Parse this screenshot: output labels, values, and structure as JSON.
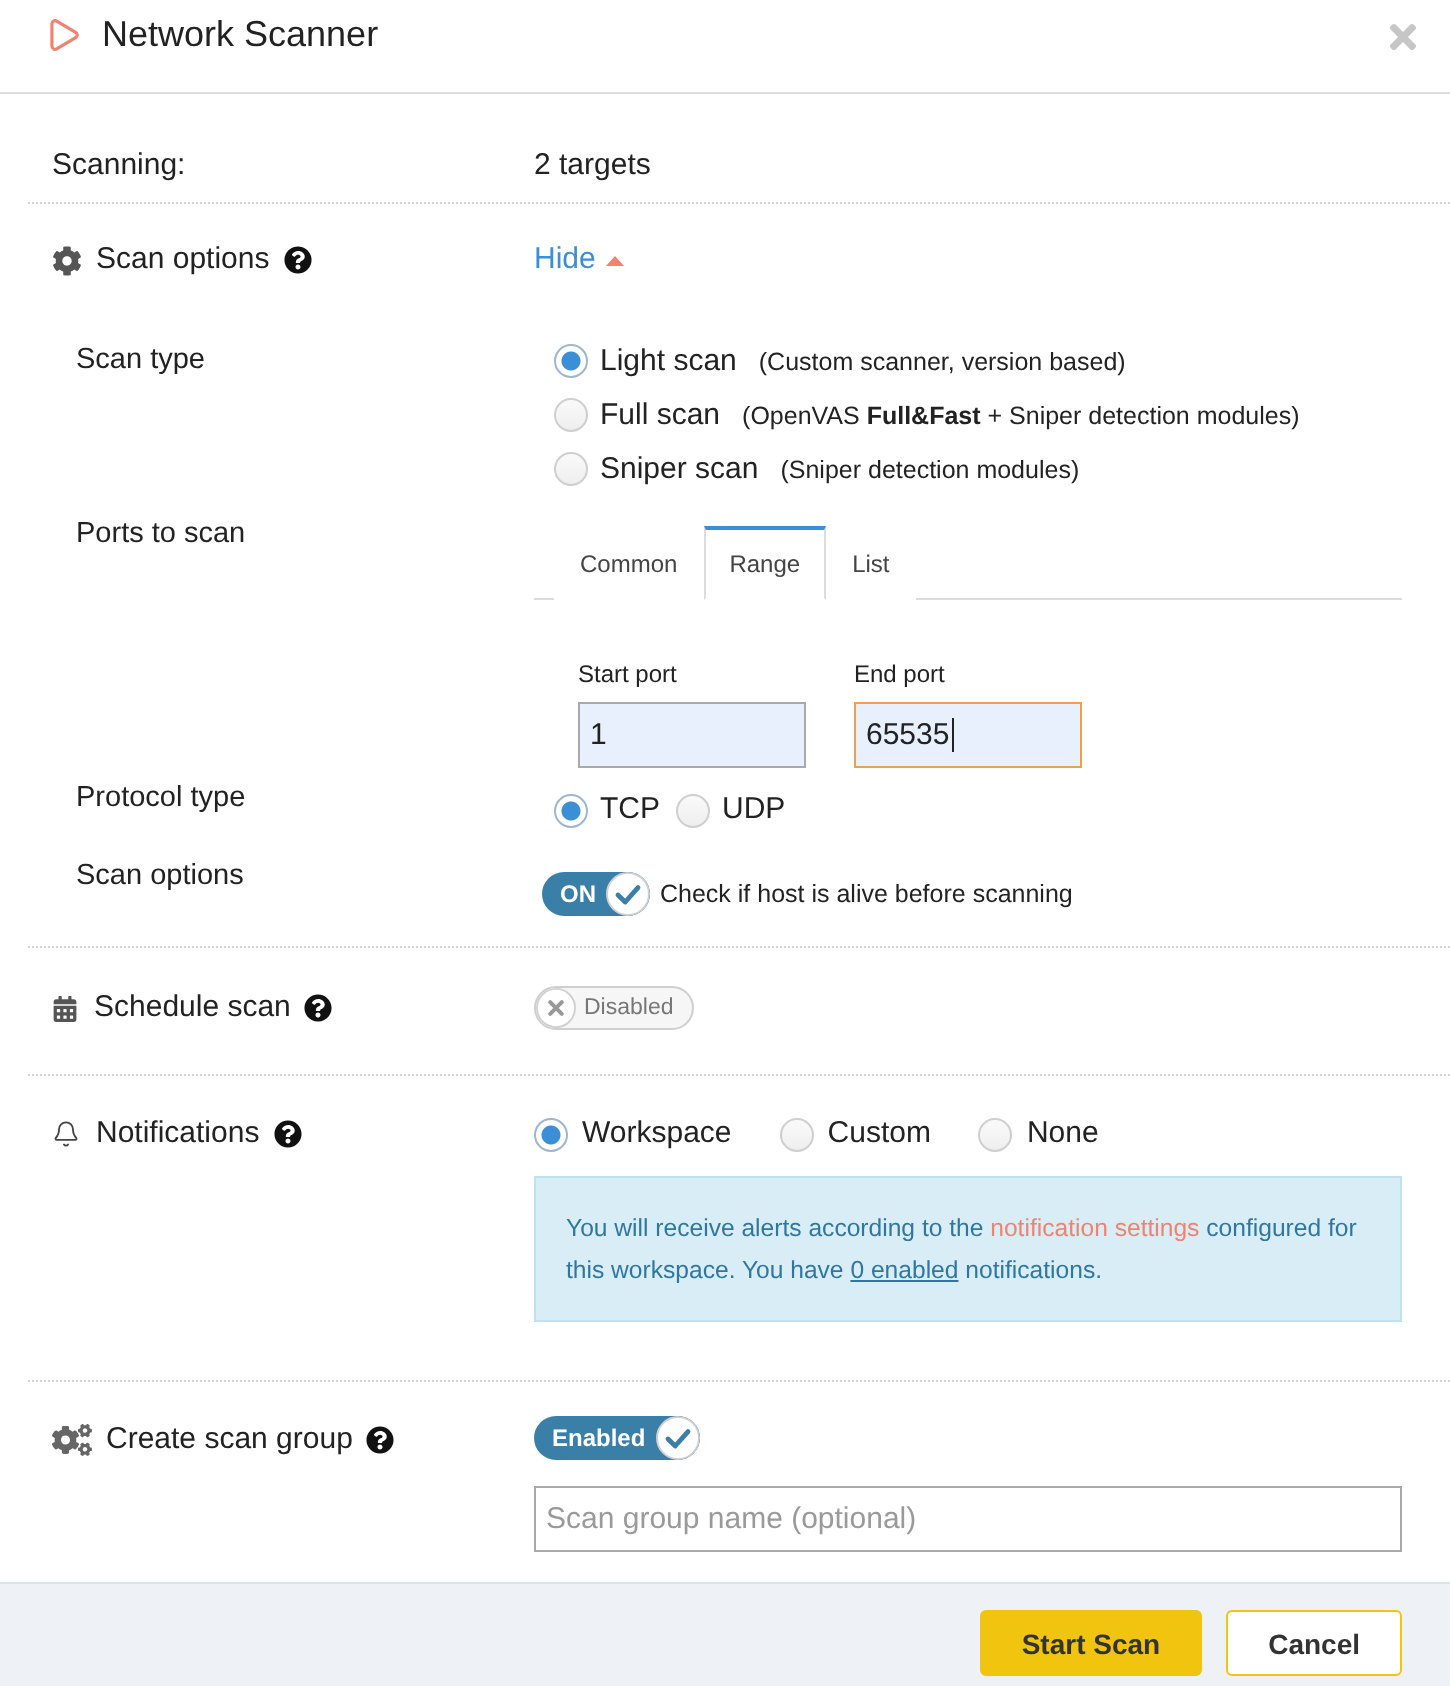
{
  "dialog": {
    "title": "Network Scanner"
  },
  "scanning": {
    "label": "Scanning:",
    "value": "2 targets"
  },
  "scan_options": {
    "label": "Scan options",
    "toggle_link": "Hide",
    "expanded": true,
    "scan_type": {
      "label": "Scan type",
      "options": [
        {
          "label": "Light scan",
          "description": "(Custom scanner, version based)",
          "selected": true
        },
        {
          "label": "Full scan",
          "description": "(OpenVAS **Full&Fast** + Sniper detection modules)",
          "selected": false
        },
        {
          "label": "Sniper scan",
          "description": "(Sniper detection modules)",
          "selected": false
        }
      ]
    },
    "ports": {
      "label": "Ports to scan",
      "tabs": [
        {
          "label": "Common",
          "selected": false
        },
        {
          "label": "Range",
          "selected": true
        },
        {
          "label": "List",
          "selected": false
        }
      ],
      "fields": [
        {
          "label": "Start port",
          "value": "1",
          "focused": false
        },
        {
          "label": "End port",
          "value": "65535",
          "focused": true
        }
      ]
    },
    "protocol": {
      "label": "Protocol type",
      "options": [
        {
          "label": "TCP",
          "selected": true
        },
        {
          "label": "UDP",
          "selected": false
        }
      ]
    },
    "host_check": {
      "label": "Scan options",
      "switch": {
        "text": "ON",
        "on": true
      },
      "description": "Check if host is alive before scanning"
    }
  },
  "schedule": {
    "label": "Schedule scan",
    "switch": {
      "text": "Disabled",
      "on": false
    }
  },
  "notifications": {
    "label": "Notifications",
    "options": [
      {
        "label": "Workspace",
        "selected": true
      },
      {
        "label": "Custom",
        "selected": false
      },
      {
        "label": "None",
        "selected": false
      }
    ],
    "info": [
      {
        "kind": "text",
        "text": "You will receive alerts according to the "
      },
      {
        "kind": "settings_link",
        "text": "notification settings"
      },
      {
        "kind": "text",
        "text": " configured for this workspace. You have "
      },
      {
        "kind": "count_link",
        "text": "0 enabled"
      },
      {
        "kind": "text",
        "text": " notifications."
      }
    ]
  },
  "scan_group": {
    "label": "Create scan group",
    "switch": {
      "text": "Enabled",
      "on": true
    },
    "name_field": {
      "placeholder": "Scan group name (optional)"
    }
  },
  "footer": {
    "buttons": [
      {
        "label": "Start Scan",
        "kind": "primary"
      },
      {
        "label": "Cancel",
        "kind": "secondary"
      }
    ]
  }
}
